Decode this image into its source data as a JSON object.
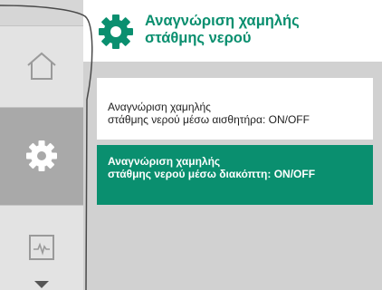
{
  "header": {
    "title_line1": "Αναγνώριση χαμηλής",
    "title_line2": "στάθμης νερού",
    "icon": "gear-icon"
  },
  "sidebar": {
    "items": [
      {
        "icon": "home-icon"
      },
      {
        "icon": "gear-icon",
        "selected": true
      },
      {
        "icon": "status-chart-icon"
      }
    ],
    "scroll_indicator": "chevron-down-icon"
  },
  "options": [
    {
      "line1": "Αναγνώριση χαμηλής",
      "line2": "στάθμης νερού μέσω αισθητήρα: ON/OFF",
      "selected": false
    },
    {
      "line1": "Αναγνώριση χαμηλής",
      "line2": "στάθμης νερού μέσω διακόπτη: ON/OFF",
      "selected": true
    }
  ],
  "colors": {
    "accent": "#0a8f6f",
    "panel": "#d1d1d1",
    "sidebar_selected": "#a9a9a9"
  }
}
